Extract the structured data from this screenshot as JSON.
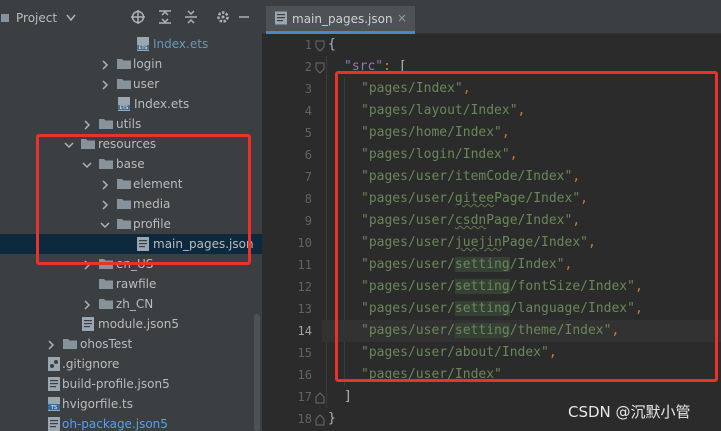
{
  "project_panel": {
    "title": "Project",
    "tree": [
      {
        "label": "Index.ets",
        "icon": "ets-file-icon",
        "style": "blue"
      },
      {
        "label": "login",
        "icon": "folder-icon",
        "style": "normal"
      },
      {
        "label": "user",
        "icon": "folder-icon",
        "style": "normal"
      },
      {
        "label": "Index.ets",
        "icon": "ets-file-icon",
        "style": "normal"
      },
      {
        "label": "utils",
        "icon": "folder-icon",
        "style": "normal"
      },
      {
        "label": "resources",
        "icon": "folder-icon",
        "style": "normal"
      },
      {
        "label": "base",
        "icon": "folder-icon",
        "style": "normal"
      },
      {
        "label": "element",
        "icon": "folder-icon",
        "style": "normal"
      },
      {
        "label": "media",
        "icon": "folder-icon",
        "style": "normal"
      },
      {
        "label": "profile",
        "icon": "folder-icon",
        "style": "normal"
      },
      {
        "label": "main_pages.json",
        "icon": "json-file-icon",
        "style": "normal",
        "selected": true
      },
      {
        "label": "en_US",
        "icon": "folder-icon",
        "style": "normal"
      },
      {
        "label": "rawfile",
        "icon": "folder-icon",
        "style": "normal"
      },
      {
        "label": "zh_CN",
        "icon": "folder-icon",
        "style": "normal"
      },
      {
        "label": "module.json5",
        "icon": "json-file-icon",
        "style": "normal"
      },
      {
        "label": "ohosTest",
        "icon": "folder-icon",
        "style": "normal"
      },
      {
        "label": ".gitignore",
        "icon": "gitignore-icon",
        "style": "normal"
      },
      {
        "label": "build-profile.json5",
        "icon": "json-file-icon",
        "style": "normal"
      },
      {
        "label": "hvigorfile.ts",
        "icon": "ts-file-icon",
        "style": "normal"
      },
      {
        "label": "oh-package.json5",
        "icon": "json-file-icon",
        "style": "link"
      }
    ]
  },
  "editor": {
    "tab_label": "main_pages.json",
    "tab_close": "×",
    "line_numbers": [
      "1",
      "2",
      "3",
      "4",
      "5",
      "6",
      "7",
      "8",
      "9",
      "10",
      "11",
      "12",
      "13",
      "14",
      "15",
      "16",
      "17",
      "18"
    ],
    "current_line": "14",
    "lines": [
      {
        "brace": "{"
      },
      {
        "key": "\"src\"",
        "punc": ": ",
        "open": "["
      },
      {
        "str": "\"pages/Index\"",
        "comma": ","
      },
      {
        "str": "\"pages/layout/Index\"",
        "comma": ","
      },
      {
        "str": "\"pages/home/Index\"",
        "comma": ","
      },
      {
        "str": "\"pages/login/Index\"",
        "comma": ","
      },
      {
        "str": "\"pages/user/itemCode/Index\"",
        "comma": ","
      },
      {
        "str": "\"pages/user/giteePage/Index\"",
        "comma": ","
      },
      {
        "str": "\"pages/user/csdnPage/Index\"",
        "comma": ","
      },
      {
        "str": "\"pages/user/juejinPage/Index\"",
        "comma": ","
      },
      {
        "str": "\"pages/user/setting/Index\"",
        "comma": ","
      },
      {
        "str": "\"pages/user/setting/fontSize/Index\"",
        "comma": ","
      },
      {
        "str": "\"pages/user/setting/language/Index\"",
        "comma": ","
      },
      {
        "str": "\"pages/user/setting/theme/Index\"",
        "comma": ","
      },
      {
        "str": "\"pages/user/about/Index\"",
        "comma": ","
      },
      {
        "str": "\"pages/user/Index\"",
        "comma": ""
      },
      {
        "brace": "]"
      },
      {
        "brace": "}"
      }
    ]
  },
  "watermark": "CSDN @沉默小管",
  "colors": {
    "annotation_red": "#e8322b",
    "string_green": "#6a8759",
    "key_purple": "#9876aa",
    "panel_bg": "#3c3f41",
    "editor_bg": "#2b2b2b"
  }
}
